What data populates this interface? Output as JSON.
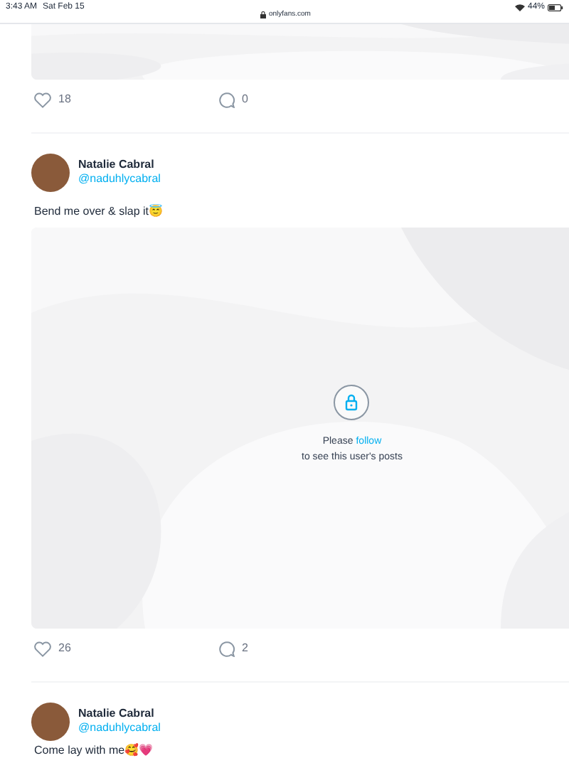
{
  "status_bar": {
    "time": "3:43 AM",
    "date": "Sat Feb 15",
    "url": "onlyfans.com",
    "battery": "44%"
  },
  "posts": [
    {
      "kind": "partial",
      "media": {
        "kind": "wave"
      },
      "likes": "18",
      "comments": "0"
    },
    {
      "kind": "full",
      "author": "Natalie Cabral",
      "handle": "@naduhlycabral",
      "text": "Bend me over & slap it😇",
      "media": {
        "kind": "locked",
        "message_before": "Please",
        "link": "follow",
        "message_after": "to see this user's posts"
      },
      "likes": "26",
      "comments": "2"
    },
    {
      "kind": "header",
      "author": "Natalie Cabral",
      "handle": "@naduhlycabral",
      "text": "Come lay with me🥰💗"
    }
  ]
}
